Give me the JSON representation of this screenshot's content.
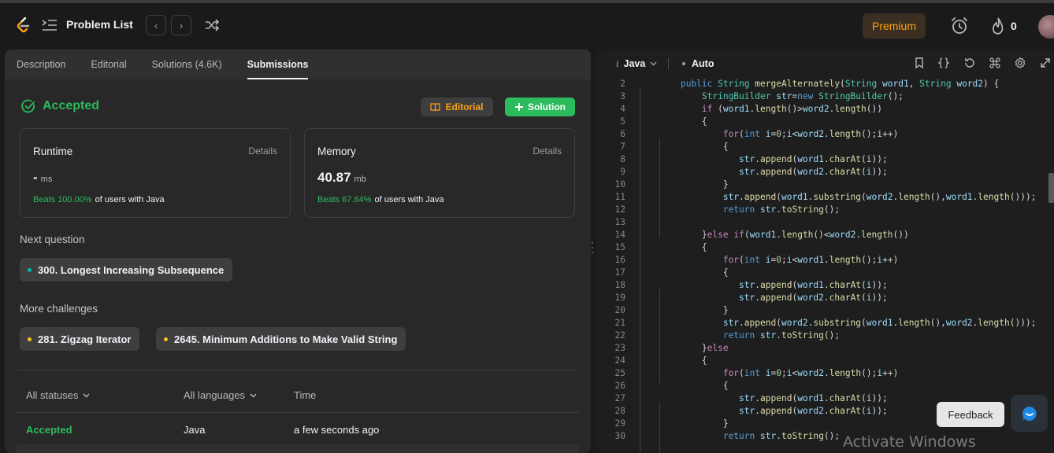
{
  "topbar": {
    "problem_list": "Problem List",
    "premium": "Premium",
    "streak": "0"
  },
  "tabs": [
    {
      "label": "Description"
    },
    {
      "label": "Editorial"
    },
    {
      "label": "Solutions (4.6K)"
    },
    {
      "label": "Submissions"
    }
  ],
  "result": {
    "status": "Accepted",
    "editorial_label": "Editorial",
    "solution_label": "Solution"
  },
  "runtime": {
    "label": "Runtime",
    "details": "Details",
    "value": "-",
    "unit": "ms",
    "beats": "Beats 100.00%",
    "beats_suffix": "of users with Java"
  },
  "memory": {
    "label": "Memory",
    "details": "Details",
    "value": "40.87",
    "unit": "mb",
    "beats": "Beats 67.64%",
    "beats_suffix": "of users with Java"
  },
  "next_question": {
    "title": "Next question",
    "item": "300. Longest Increasing Subsequence",
    "dot_color": "#00b8a3"
  },
  "more_challenges": {
    "title": "More challenges",
    "items": [
      "281. Zigzag Iterator",
      "2645. Minimum Additions to Make Valid String"
    ],
    "dot_color": "#ffc01e"
  },
  "submissions_table": {
    "headers": [
      "All statuses",
      "All languages",
      "Time"
    ],
    "rows": [
      {
        "status": "Accepted",
        "language": "Java",
        "time": "a few seconds ago"
      }
    ]
  },
  "editor": {
    "language": "Java",
    "mode": "Auto",
    "lines": [
      {
        "n": "2",
        "text": "    public String mergeAlternately(String word1, String word2) {"
      },
      {
        "n": "3",
        "text": "        StringBuilder str=new StringBuilder();"
      },
      {
        "n": "4",
        "text": "        if (word1.length()>word2.length())"
      },
      {
        "n": "5",
        "text": "        {"
      },
      {
        "n": "6",
        "text": "            for(int i=0;i<word2.length();i++)"
      },
      {
        "n": "7",
        "text": "            {"
      },
      {
        "n": "8",
        "text": "               str.append(word1.charAt(i));"
      },
      {
        "n": "9",
        "text": "               str.append(word2.charAt(i));"
      },
      {
        "n": "10",
        "text": "            }"
      },
      {
        "n": "11",
        "text": "            str.append(word1.substring(word2.length(),word1.length()));"
      },
      {
        "n": "12",
        "text": "            return str.toString();"
      },
      {
        "n": "13",
        "text": ""
      },
      {
        "n": "14",
        "text": "        }else if(word1.length()<word2.length())"
      },
      {
        "n": "15",
        "text": "        {"
      },
      {
        "n": "16",
        "text": "            for(int i=0;i<word1.length();i++)"
      },
      {
        "n": "17",
        "text": "            {"
      },
      {
        "n": "18",
        "text": "               str.append(word1.charAt(i));"
      },
      {
        "n": "19",
        "text": "               str.append(word2.charAt(i));"
      },
      {
        "n": "20",
        "text": "            }"
      },
      {
        "n": "21",
        "text": "            str.append(word2.substring(word1.length(),word2.length()));"
      },
      {
        "n": "22",
        "text": "            return str.toString();"
      },
      {
        "n": "23",
        "text": "        }else"
      },
      {
        "n": "24",
        "text": "        {"
      },
      {
        "n": "25",
        "text": "            for(int i=0;i<word2.length();i++)"
      },
      {
        "n": "26",
        "text": "            {"
      },
      {
        "n": "27",
        "text": "               str.append(word1.charAt(i));"
      },
      {
        "n": "28",
        "text": "               str.append(word2.charAt(i));"
      },
      {
        "n": "29",
        "text": "            }"
      },
      {
        "n": "30",
        "text": "            return str.toString();"
      }
    ]
  },
  "feedback": "Feedback",
  "watermark": "Activate Windows",
  "colors": {
    "accent_green": "#2cbb5d",
    "premium_orange": "#ffa116"
  }
}
